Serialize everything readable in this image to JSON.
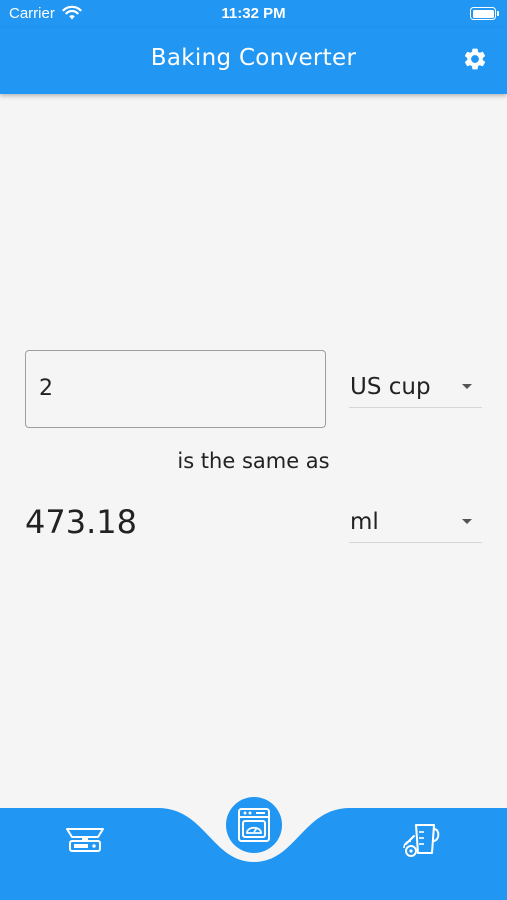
{
  "status_bar": {
    "carrier": "Carrier",
    "time": "11:32 PM",
    "battery_level": 1.0
  },
  "app_bar": {
    "title": "Baking Converter",
    "settings_icon": "gear-icon"
  },
  "converter": {
    "amount_value": "2",
    "from_unit": "US cup",
    "connector_text": "is the same as",
    "result_value": "473.18",
    "to_unit": "ml"
  },
  "bottom_nav": {
    "items": [
      {
        "icon": "kitchen-scale-icon",
        "active": false
      },
      {
        "icon": "oven-icon",
        "active": true
      },
      {
        "icon": "measuring-jug-icon",
        "active": false
      }
    ]
  },
  "colors": {
    "primary": "#2196f3",
    "background": "#f5f5f5",
    "text": "#222222"
  }
}
